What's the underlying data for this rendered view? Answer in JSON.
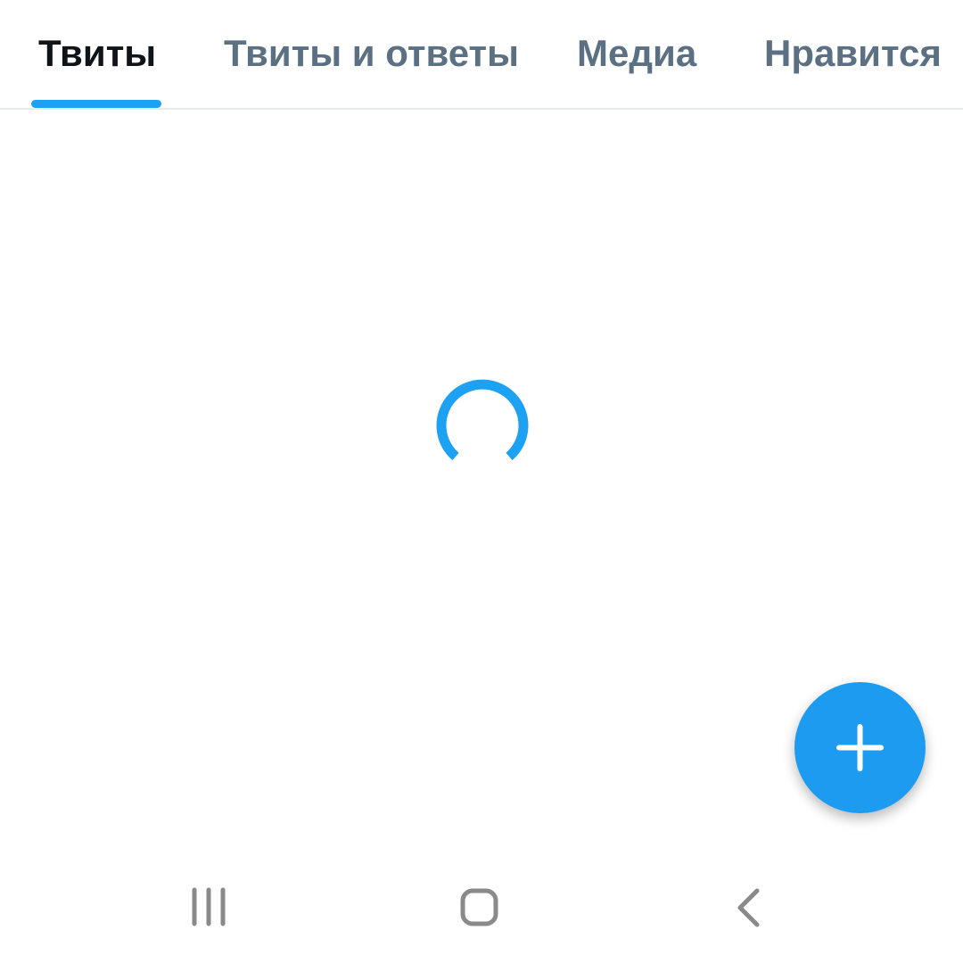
{
  "tabs": [
    {
      "label": "Твиты",
      "active": true
    },
    {
      "label": "Твиты и ответы",
      "active": false
    },
    {
      "label": "Медиа",
      "active": false
    },
    {
      "label": "Нравится",
      "active": false
    }
  ],
  "content": {
    "state": "loading",
    "spinner_icon": "loading-spinner-icon"
  },
  "compose_button": {
    "icon": "plus-icon"
  },
  "system_nav": {
    "recents_icon": "recents-icon",
    "home_icon": "home-icon",
    "back_icon": "back-icon"
  },
  "colors": {
    "accent": "#1da1f2",
    "active_tab_text": "#0f1419",
    "inactive_tab_text": "#5b7083",
    "divider": "#e6ecf0",
    "system_nav_icon": "#8a8a8a"
  }
}
